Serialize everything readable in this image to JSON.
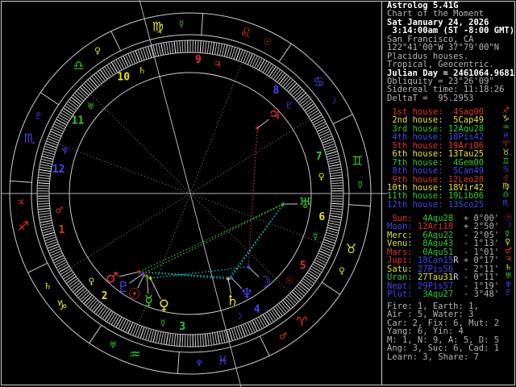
{
  "palette": {
    "red": "#e23228",
    "yellow": "#e3e32a",
    "green": "#2ecc2e",
    "blue": "#4545ee",
    "cyan": "#00d4d4",
    "gray": "#b5b5b5",
    "white": "#ffffff",
    "dim": "#8f8f8f",
    "line": "#cccccc"
  },
  "header": {
    "lines": [
      {
        "text": "Astrolog 5.41G",
        "bright": true
      },
      {
        "text": "Chart of the Moment",
        "bright": false
      },
      {
        "text": "Sat January 24, 2026",
        "bright": true
      },
      {
        "text": " 3:14:00am (ST -8:00 GMT)",
        "bright": true
      },
      {
        "text": "San Francisco, CA",
        "bright": false
      },
      {
        "text": "122°41'00\"W 37°79'00\"N",
        "bright": false
      },
      {
        "text": "Placidus houses.",
        "bright": false
      },
      {
        "text": "Tropical, Geocentric.",
        "bright": false
      },
      {
        "text": "Julian Day = 2461064.9681",
        "bright": true
      },
      {
        "text": "Obliquity = 23°26'09\"",
        "bright": false
      },
      {
        "text": "Sidereal time: 11:18:26",
        "bright": false
      },
      {
        "text": "DeltaT =  95.2953",
        "bright": false
      }
    ]
  },
  "houses": [
    {
      "label": " 1st house:",
      "value": " 4Sag00",
      "element": "fire",
      "sign_glyph": "♐"
    },
    {
      "label": " 2nd house:",
      "value": " 5Cap49",
      "element": "earth",
      "sign_glyph": "♑"
    },
    {
      "label": " 3rd house:",
      "value": "12Aqu28",
      "element": "air",
      "sign_glyph": "♒"
    },
    {
      "label": " 4th house:",
      "value": "18Pis42",
      "element": "water",
      "sign_glyph": "♓"
    },
    {
      "label": " 5th house:",
      "value": "19Ari06",
      "element": "fire",
      "sign_glyph": "♈"
    },
    {
      "label": " 6th house:",
      "value": "13Tau25",
      "element": "earth",
      "sign_glyph": "♉"
    },
    {
      "label": " 7th house:",
      "value": " 4Gem00",
      "element": "air",
      "sign_glyph": "♊"
    },
    {
      "label": " 8th house:",
      "value": " 5Can49",
      "element": "water",
      "sign_glyph": "♋"
    },
    {
      "label": " 9th house:",
      "value": "12Leo28",
      "element": "fire",
      "sign_glyph": "♌"
    },
    {
      "label": "10th house:",
      "value": "18Vir42",
      "element": "earth",
      "sign_glyph": "♍"
    },
    {
      "label": "11th house:",
      "value": "19Lib06",
      "element": "air",
      "sign_glyph": "♎"
    },
    {
      "label": "12th house:",
      "value": "13Sco25",
      "element": "water",
      "sign_glyph": "♏"
    }
  ],
  "planets": [
    {
      "label": " Sun:",
      "label_color": "red",
      "value": "  4Aqu28",
      "value_color": "green",
      "retro": false,
      "dev": "+ 0°00'",
      "glyph": "☉",
      "glyph_color": "red",
      "lon": 304.467,
      "disp_theta": 241.1
    },
    {
      "label": "Moon:",
      "label_color": "blue",
      "value": " 12Ari18",
      "value_color": "red",
      "retro": false,
      "dev": "+ 2°50'",
      "glyph": "☽",
      "glyph_color": "blue",
      "lon": 12.3,
      "disp_theta": 309.9
    },
    {
      "label": "Merc:",
      "label_color": "yellow",
      "value": "  6Aqu22",
      "value_color": "green",
      "retro": false,
      "dev": "- 2°05'",
      "glyph": "☿",
      "glyph_color": "green",
      "lon": 306.367,
      "disp_theta": 248.9
    },
    {
      "label": "Venu:",
      "label_color": "yellow",
      "value": "  8Aqu43",
      "value_color": "green",
      "retro": false,
      "dev": "- 1°13'",
      "glyph": "♀",
      "glyph_color": "yellow",
      "lon": 308.717,
      "disp_theta": 256.8
    },
    {
      "label": "Mars:",
      "label_color": "red",
      "value": "  0Aqu51",
      "value_color": "green",
      "retro": false,
      "dev": "- 1°01'",
      "glyph": "♂",
      "glyph_color": "red",
      "lon": 300.85,
      "disp_theta": 227.2
    },
    {
      "label": "Jupi:",
      "label_color": "red",
      "value": " 18Can15",
      "value_color": "blue",
      "retro": true,
      "dev": "+ 0°17'",
      "glyph": "♃",
      "glyph_color": "red",
      "lon": 108.25,
      "disp_theta": 43.0
    },
    {
      "label": "Satu:",
      "label_color": "yellow",
      "value": " 27Pis56",
      "value_color": "blue",
      "retro": false,
      "dev": "- 2°11'",
      "glyph": "♄",
      "glyph_color": "yellow",
      "lon": 357.933,
      "disp_theta": 291.4
    },
    {
      "label": "Uran:",
      "label_color": "green",
      "value": " 27Tau31",
      "value_color": "yellow",
      "retro": true,
      "dev": "- 0°11'",
      "glyph": "♅",
      "glyph_color": "green",
      "lon": 57.517,
      "disp_theta": 354.9
    },
    {
      "label": "Nept:",
      "label_color": "blue",
      "value": " 29Pis57",
      "value_color": "blue",
      "retro": false,
      "dev": "- 1°19'",
      "glyph": "♆",
      "glyph_color": "blue",
      "lon": 359.95,
      "disp_theta": 299.4
    },
    {
      "label": "Plut:",
      "label_color": "blue",
      "value": "  3Aqu27",
      "value_color": "green",
      "retro": false,
      "dev": "- 3°48'",
      "glyph": "♇",
      "glyph_color": "blue",
      "lon": 303.45,
      "disp_theta": 234.5
    }
  ],
  "stats": [
    "Fire: 1, Earth: 1,",
    "Air : 5, Water: 3",
    "Car: 2, Fix: 6, Mut: 2",
    "Yang: 6, Yin: 4",
    "M: 1, N: 9, A: 5, D: 5",
    "Ang: 3, Suc: 6, Cad: 1",
    "Learn: 3, Share: 7"
  ],
  "wheel": {
    "ascendant": 244.0,
    "cusps": [
      244.0,
      275.817,
      312.467,
      348.7,
      19.1,
      43.417,
      64.0,
      95.817,
      132.467,
      168.7,
      199.1,
      223.417
    ],
    "signs": [
      {
        "glyph": "♈",
        "element": "fire",
        "ruler": "♂",
        "ruler_color": "red"
      },
      {
        "glyph": "♉",
        "element": "earth",
        "ruler": "♀",
        "ruler_color": "yellow"
      },
      {
        "glyph": "♊",
        "element": "air",
        "ruler": "☿",
        "ruler_color": "green"
      },
      {
        "glyph": "♋",
        "element": "water",
        "ruler": "☽",
        "ruler_color": "blue"
      },
      {
        "glyph": "♌",
        "element": "fire",
        "ruler": "☉",
        "ruler_color": "red"
      },
      {
        "glyph": "♍",
        "element": "earth",
        "ruler": "☿",
        "ruler_color": "green"
      },
      {
        "glyph": "♎",
        "element": "air",
        "ruler": "♀",
        "ruler_color": "yellow"
      },
      {
        "glyph": "♏",
        "element": "water",
        "ruler": "♇",
        "ruler_color": "blue"
      },
      {
        "glyph": "♐",
        "element": "fire",
        "ruler": "♃",
        "ruler_color": "red"
      },
      {
        "glyph": "♑",
        "element": "earth",
        "ruler": "♄",
        "ruler_color": "yellow"
      },
      {
        "glyph": "♒",
        "element": "air",
        "ruler": "♅",
        "ruler_color": "green"
      },
      {
        "glyph": "♓",
        "element": "water",
        "ruler": "♆",
        "ruler_color": "blue"
      }
    ],
    "house_rulers": [
      {
        "glyph": "♂",
        "color": "red"
      },
      {
        "glyph": "♀",
        "color": "yellow"
      },
      {
        "glyph": "☿",
        "color": "green"
      },
      {
        "glyph": "☽",
        "color": "blue"
      },
      {
        "glyph": "☉",
        "color": "red"
      },
      {
        "glyph": "☿",
        "color": "green"
      },
      {
        "glyph": "♀",
        "color": "yellow"
      },
      {
        "glyph": "♇",
        "color": "blue"
      },
      {
        "glyph": "♃",
        "color": "red"
      },
      {
        "glyph": "♄",
        "color": "yellow"
      },
      {
        "glyph": "♅",
        "color": "green"
      },
      {
        "glyph": "♆",
        "color": "blue"
      }
    ],
    "aspects": [
      {
        "a": 4,
        "b": 6,
        "color": "cyan"
      },
      {
        "a": 4,
        "b": 8,
        "color": "cyan"
      },
      {
        "a": 6,
        "b": 7,
        "color": "cyan"
      },
      {
        "a": 8,
        "b": 7,
        "color": "cyan"
      },
      {
        "a": 3,
        "b": 1,
        "color": "cyan"
      },
      {
        "a": 4,
        "b": 7,
        "color": "green"
      },
      {
        "a": 9,
        "b": 7,
        "color": "green"
      },
      {
        "a": 5,
        "b": 1,
        "color": "red"
      },
      {
        "a": 0,
        "b": 2,
        "color": "yellow"
      },
      {
        "a": 0,
        "b": 9,
        "color": "yellow"
      },
      {
        "a": 4,
        "b": 9,
        "color": "yellow"
      },
      {
        "a": 2,
        "b": 3,
        "color": "yellow"
      },
      {
        "a": 6,
        "b": 8,
        "color": "yellow"
      }
    ]
  }
}
